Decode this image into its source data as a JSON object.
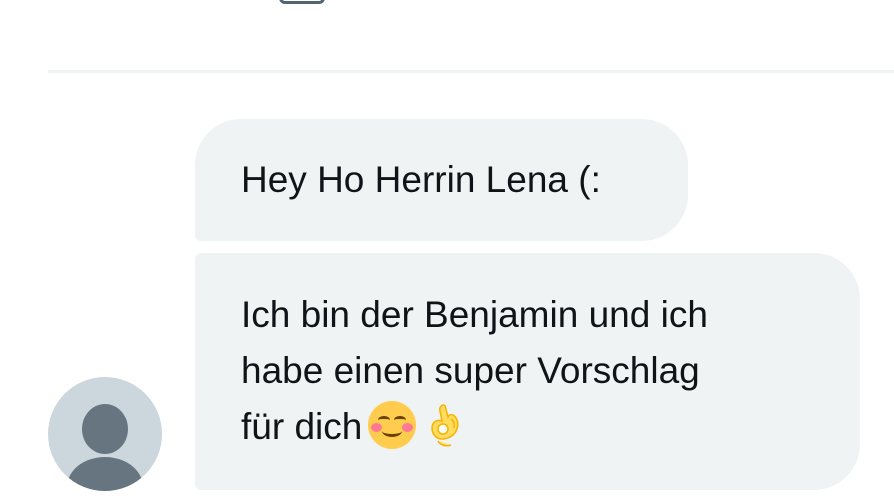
{
  "conversation": {
    "messages": [
      {
        "lines": [
          "Hey Ho Herrin Lena (:"
        ]
      },
      {
        "lines": [
          "Ich bin der Benjamin und ich",
          "habe einen super Vorschlag",
          "für dich"
        ],
        "emojis": [
          "smiling-face-with-smiling-eyes",
          "ok-hand"
        ]
      }
    ],
    "sender_avatar": "default-profile-avatar"
  },
  "colors": {
    "bubble_background": "#eff3f4",
    "text": "#0f1419",
    "avatar_background": "#ccd6dd",
    "avatar_figure": "#66757f"
  }
}
